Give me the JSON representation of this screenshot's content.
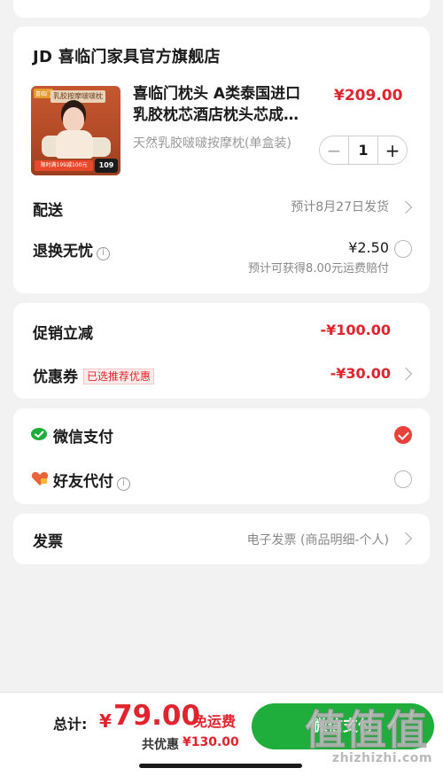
{
  "store": {
    "name": "JD 喜临门家具官方旗舰店",
    "product": {
      "title_line1": "喜临门枕头 A类泰国进口",
      "title_line2": "乳胶枕芯酒店枕头芯成…",
      "price": "¥209.00",
      "spec": "天然乳胶啵啵按摩枕(单盒装)",
      "quantity": "1",
      "image": {
        "banner_text": "乳胶按摩啵啵枕",
        "promo_strip": "限时满199减100元",
        "price_badge": "109"
      }
    },
    "delivery": {
      "label": "配送",
      "value": "预计8月27日发货"
    },
    "return_service": {
      "label": "退换无忧",
      "price": "¥2.50",
      "note": "预计可获得8.00元运费赔付"
    }
  },
  "promotions": {
    "discount_label": "促销立减",
    "discount_value": "-¥100.00",
    "coupon_label": "优惠券",
    "coupon_tag": "已选推荐优惠",
    "coupon_value": "-¥30.00"
  },
  "payment": {
    "options": [
      {
        "label": "微信支付",
        "icon": "wechat-pay-icon",
        "selected": true
      },
      {
        "label": "好友代付",
        "icon": "friend-pay-icon",
        "selected": false
      }
    ]
  },
  "invoice": {
    "label": "发票",
    "value": "电子发票 (商品明细-个人)"
  },
  "footer": {
    "total_label": "总计:",
    "currency": "¥",
    "total_amount": "79.00",
    "free_shipping": "免运费",
    "saving_label": "共优惠",
    "saving_amount": "¥130.00",
    "pay_button": "微信支付"
  },
  "watermark": {
    "site": "zhizhizhi.com",
    "logo_text": "值值值"
  },
  "colors": {
    "accent_red": "#e0232d",
    "wechat_green": "#1fad3c",
    "background": "#f2f2f2"
  }
}
